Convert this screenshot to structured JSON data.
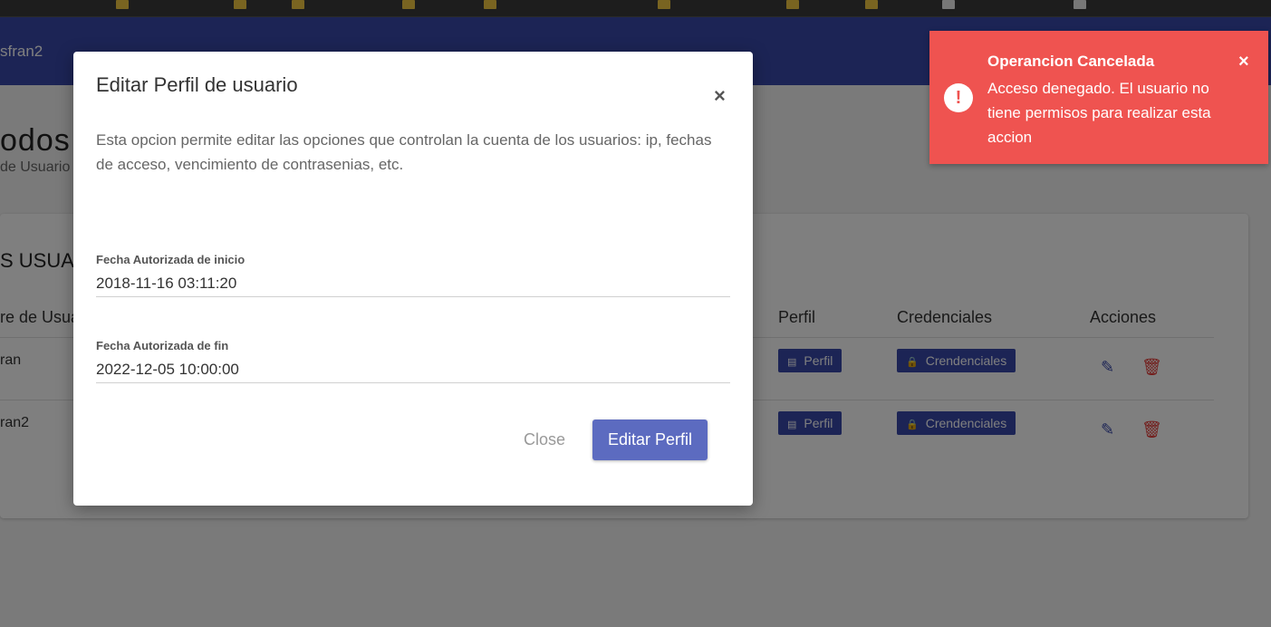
{
  "app": {
    "current_user": "sfran2",
    "page_title": "odos l",
    "page_subtitle": "de Usuario",
    "card_title": "S USUA"
  },
  "table": {
    "columns": [
      "re de Usua",
      "Perfil",
      "Credenciales",
      "Acciones"
    ],
    "rows": [
      {
        "user": "ran",
        "perfil": "Perfil",
        "credenciales": "Crendenciales"
      },
      {
        "user": "ran2",
        "perfil": "Perfil",
        "credenciales": "Crendenciales"
      }
    ]
  },
  "modal": {
    "title": "Editar Perfil de usuario",
    "close_symbol": "×",
    "description": "Esta opcion permite editar las opciones que controlan la cuenta de los usuarios: ip, fechas de acceso, vencimiento de contrasenias, etc.",
    "fields": [
      {
        "label": "Fecha Autorizada de inicio",
        "value": "2018-11-16 03:11:20"
      },
      {
        "label": "Fecha Autorizada de fin",
        "value": "2022-12-05 10:00:00"
      }
    ],
    "close_button": "Close",
    "submit_button": "Editar Perfil"
  },
  "toast": {
    "icon_symbol": "!",
    "title": "Operancion Cancelada",
    "message": "Acceso denegado. El usuario no tiene permisos para realizar esta accion",
    "close_symbol": "×"
  },
  "icons": {
    "card": "▤",
    "lock": "🔒",
    "pencil": "✎",
    "trash": "🗑"
  },
  "colors": {
    "primary": "#3949ab",
    "button": "#5c6bc0",
    "toast": "#ef5350",
    "delete": "#e53935"
  }
}
